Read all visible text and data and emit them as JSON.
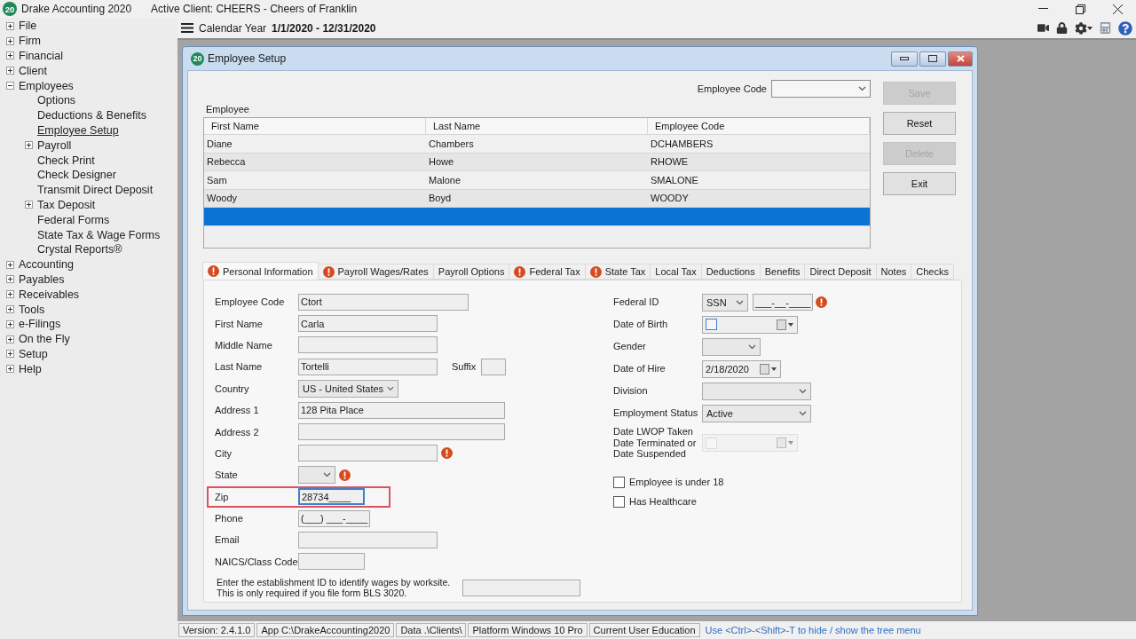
{
  "app": {
    "logo": "20",
    "title": "Drake Accounting 2020",
    "client": "Active Client: CHEERS - Cheers of Franklin"
  },
  "sidebar": {
    "items": [
      {
        "label": "File",
        "kind": "branch",
        "expanded": false,
        "selected": false
      },
      {
        "label": "Firm",
        "kind": "branch",
        "expanded": false,
        "selected": false
      },
      {
        "label": "Financial",
        "kind": "branch",
        "expanded": false,
        "selected": false
      },
      {
        "label": "Client",
        "kind": "branch",
        "expanded": false,
        "selected": false
      },
      {
        "label": "Employees",
        "kind": "branch",
        "expanded": true,
        "selected": false,
        "children": [
          {
            "label": "Options",
            "kind": "leaf",
            "selected": false
          },
          {
            "label": "Deductions & Benefits",
            "kind": "leaf",
            "selected": false
          },
          {
            "label": "Employee Setup",
            "kind": "leaf",
            "selected": true
          },
          {
            "label": "Payroll",
            "kind": "branch",
            "expanded": false,
            "selected": false
          },
          {
            "label": "Check Print",
            "kind": "leaf",
            "selected": false
          },
          {
            "label": "Check Designer",
            "kind": "leaf",
            "selected": false
          },
          {
            "label": "Transmit Direct Deposit",
            "kind": "leaf",
            "selected": false
          },
          {
            "label": "Tax Deposit",
            "kind": "branch",
            "expanded": false,
            "selected": false
          },
          {
            "label": "Federal Forms",
            "kind": "leaf",
            "selected": false
          },
          {
            "label": "State Tax & Wage Forms",
            "kind": "leaf",
            "selected": false
          },
          {
            "label": "Crystal Reports®",
            "kind": "leaf",
            "selected": false
          }
        ]
      },
      {
        "label": "Accounting",
        "kind": "branch",
        "expanded": false,
        "selected": false
      },
      {
        "label": "Payables",
        "kind": "branch",
        "expanded": false,
        "selected": false
      },
      {
        "label": "Receivables",
        "kind": "branch",
        "expanded": false,
        "selected": false
      },
      {
        "label": "Tools",
        "kind": "branch",
        "expanded": false,
        "selected": false
      },
      {
        "label": "e-Filings",
        "kind": "branch",
        "expanded": false,
        "selected": false
      },
      {
        "label": "On the Fly",
        "kind": "branch",
        "expanded": false,
        "selected": false
      },
      {
        "label": "Setup",
        "kind": "branch",
        "expanded": false,
        "selected": false
      },
      {
        "label": "Help",
        "kind": "branch",
        "expanded": false,
        "selected": false
      }
    ]
  },
  "toolbar": {
    "period_label": "Calendar Year",
    "period": "1/1/2020 - 12/31/2020"
  },
  "window": {
    "logo": "20",
    "title": "Employee Setup",
    "lookup": {
      "label": "Employee Code"
    },
    "employee_group": {
      "title": "Employee",
      "columns": [
        "First Name",
        "Last Name",
        "Employee Code"
      ],
      "rows": [
        {
          "cells": [
            "Diane",
            "Chambers",
            "DCHAMBERS"
          ],
          "selected": false
        },
        {
          "cells": [
            "Rebecca",
            "Howe",
            "RHOWE"
          ],
          "selected": false
        },
        {
          "cells": [
            "Sam",
            "Malone",
            "SMALONE"
          ],
          "selected": false
        },
        {
          "cells": [
            "Woody",
            "Boyd",
            "WOODY"
          ],
          "selected": false
        },
        {
          "selected": true
        }
      ]
    },
    "buttons": [
      {
        "label": "Save",
        "disabled": true
      },
      {
        "label": "Reset",
        "disabled": false
      },
      {
        "label": "Delete",
        "disabled": true
      },
      {
        "label": "Exit",
        "disabled": false
      }
    ],
    "tabs": [
      {
        "label": "Personal Information",
        "alert": true,
        "selected": true
      },
      {
        "label": "Payroll Wages/Rates",
        "alert": true,
        "selected": false
      },
      {
        "label": "Payroll Options",
        "alert": false,
        "selected": false
      },
      {
        "label": "Federal Tax",
        "alert": true,
        "selected": false
      },
      {
        "label": "State Tax",
        "alert": true,
        "selected": false
      },
      {
        "label": "Local Tax",
        "alert": false,
        "selected": false
      },
      {
        "label": "Deductions",
        "alert": false,
        "selected": false
      },
      {
        "label": "Benefits",
        "alert": false,
        "selected": false
      },
      {
        "label": "Direct Deposit",
        "alert": false,
        "selected": false
      },
      {
        "label": "Notes",
        "alert": false,
        "selected": false
      },
      {
        "label": "Checks",
        "alert": false,
        "selected": false
      }
    ],
    "left_fields": [
      {
        "kind": "text",
        "label": "Employee Code",
        "value": "Ctort",
        "alert": false,
        "focused": false,
        "highlighted": false
      },
      {
        "kind": "text",
        "label": "First Name",
        "value": "Carla",
        "alert": false,
        "focused": false,
        "highlighted": false
      },
      {
        "kind": "text",
        "label": "Middle Name",
        "alert": false,
        "focused": false,
        "highlighted": false
      },
      {
        "kind": "text",
        "label": "Last Name",
        "value": "Tortelli",
        "alert": false,
        "focused": false,
        "highlighted": false,
        "suffix_label": "Suffix"
      },
      {
        "kind": "select",
        "label": "Country",
        "value": "US - United States",
        "alert": false,
        "focused": false,
        "highlighted": false
      },
      {
        "kind": "text",
        "label": "Address 1",
        "value": "128 Pita Place",
        "alert": false,
        "focused": false,
        "highlighted": false
      },
      {
        "kind": "text",
        "label": "Address 2",
        "alert": false,
        "focused": false,
        "highlighted": false
      },
      {
        "kind": "text",
        "label": "City",
        "alert": true,
        "focused": false,
        "highlighted": false
      },
      {
        "kind": "select",
        "label": "State",
        "alert": true,
        "focused": false,
        "highlighted": false
      },
      {
        "kind": "text",
        "label": "Zip",
        "value": "28734____",
        "alert": false,
        "focused": true,
        "highlighted": true
      },
      {
        "kind": "text",
        "label": "Phone",
        "value": "(___) ___-____",
        "alert": false,
        "focused": false,
        "highlighted": false
      },
      {
        "kind": "text",
        "label": "Email",
        "alert": false,
        "focused": false,
        "highlighted": false
      },
      {
        "kind": "text",
        "label": "NAICS/Class Code",
        "alert": false,
        "focused": false,
        "highlighted": false
      }
    ],
    "note_lines": [
      "Enter the establishment ID to identify wages by worksite.",
      "This is only required if you file form BLS 3020."
    ],
    "right_fields": [
      {
        "kind": "id",
        "label_lines": [
          "Federal ID"
        ],
        "select": "SSN",
        "value": "___-__-____",
        "alert": true
      },
      {
        "kind": "date",
        "label_lines": [
          "Date of Birth"
        ],
        "checked": false,
        "disabled": false
      },
      {
        "kind": "select",
        "label_lines": [
          "Gender"
        ]
      },
      {
        "kind": "date",
        "label_lines": [
          "Date of Hire"
        ],
        "value": "2/18/2020",
        "disabled": false
      },
      {
        "kind": "select",
        "label_lines": [
          "Division"
        ]
      },
      {
        "kind": "select",
        "label_lines": [
          "Employment Status"
        ],
        "value": "Active"
      },
      {
        "kind": "date",
        "label_lines": [
          "Date LWOP Taken",
          "Date Terminated or",
          "Date Suspended"
        ],
        "checked": false,
        "disabled": true
      }
    ],
    "checks": [
      {
        "label": "Employee is under 18",
        "checked": false
      },
      {
        "label": "Has Healthcare",
        "checked": false
      }
    ]
  },
  "status_bar": {
    "items": [
      "Version: 2.4.1.0",
      "App C:\\DrakeAccounting2020",
      "Data .\\Clients\\",
      "Platform Windows 10 Pro",
      "Current User Education"
    ],
    "hint": "Use <Ctrl>-<Shift>-T to hide / show the tree menu"
  }
}
